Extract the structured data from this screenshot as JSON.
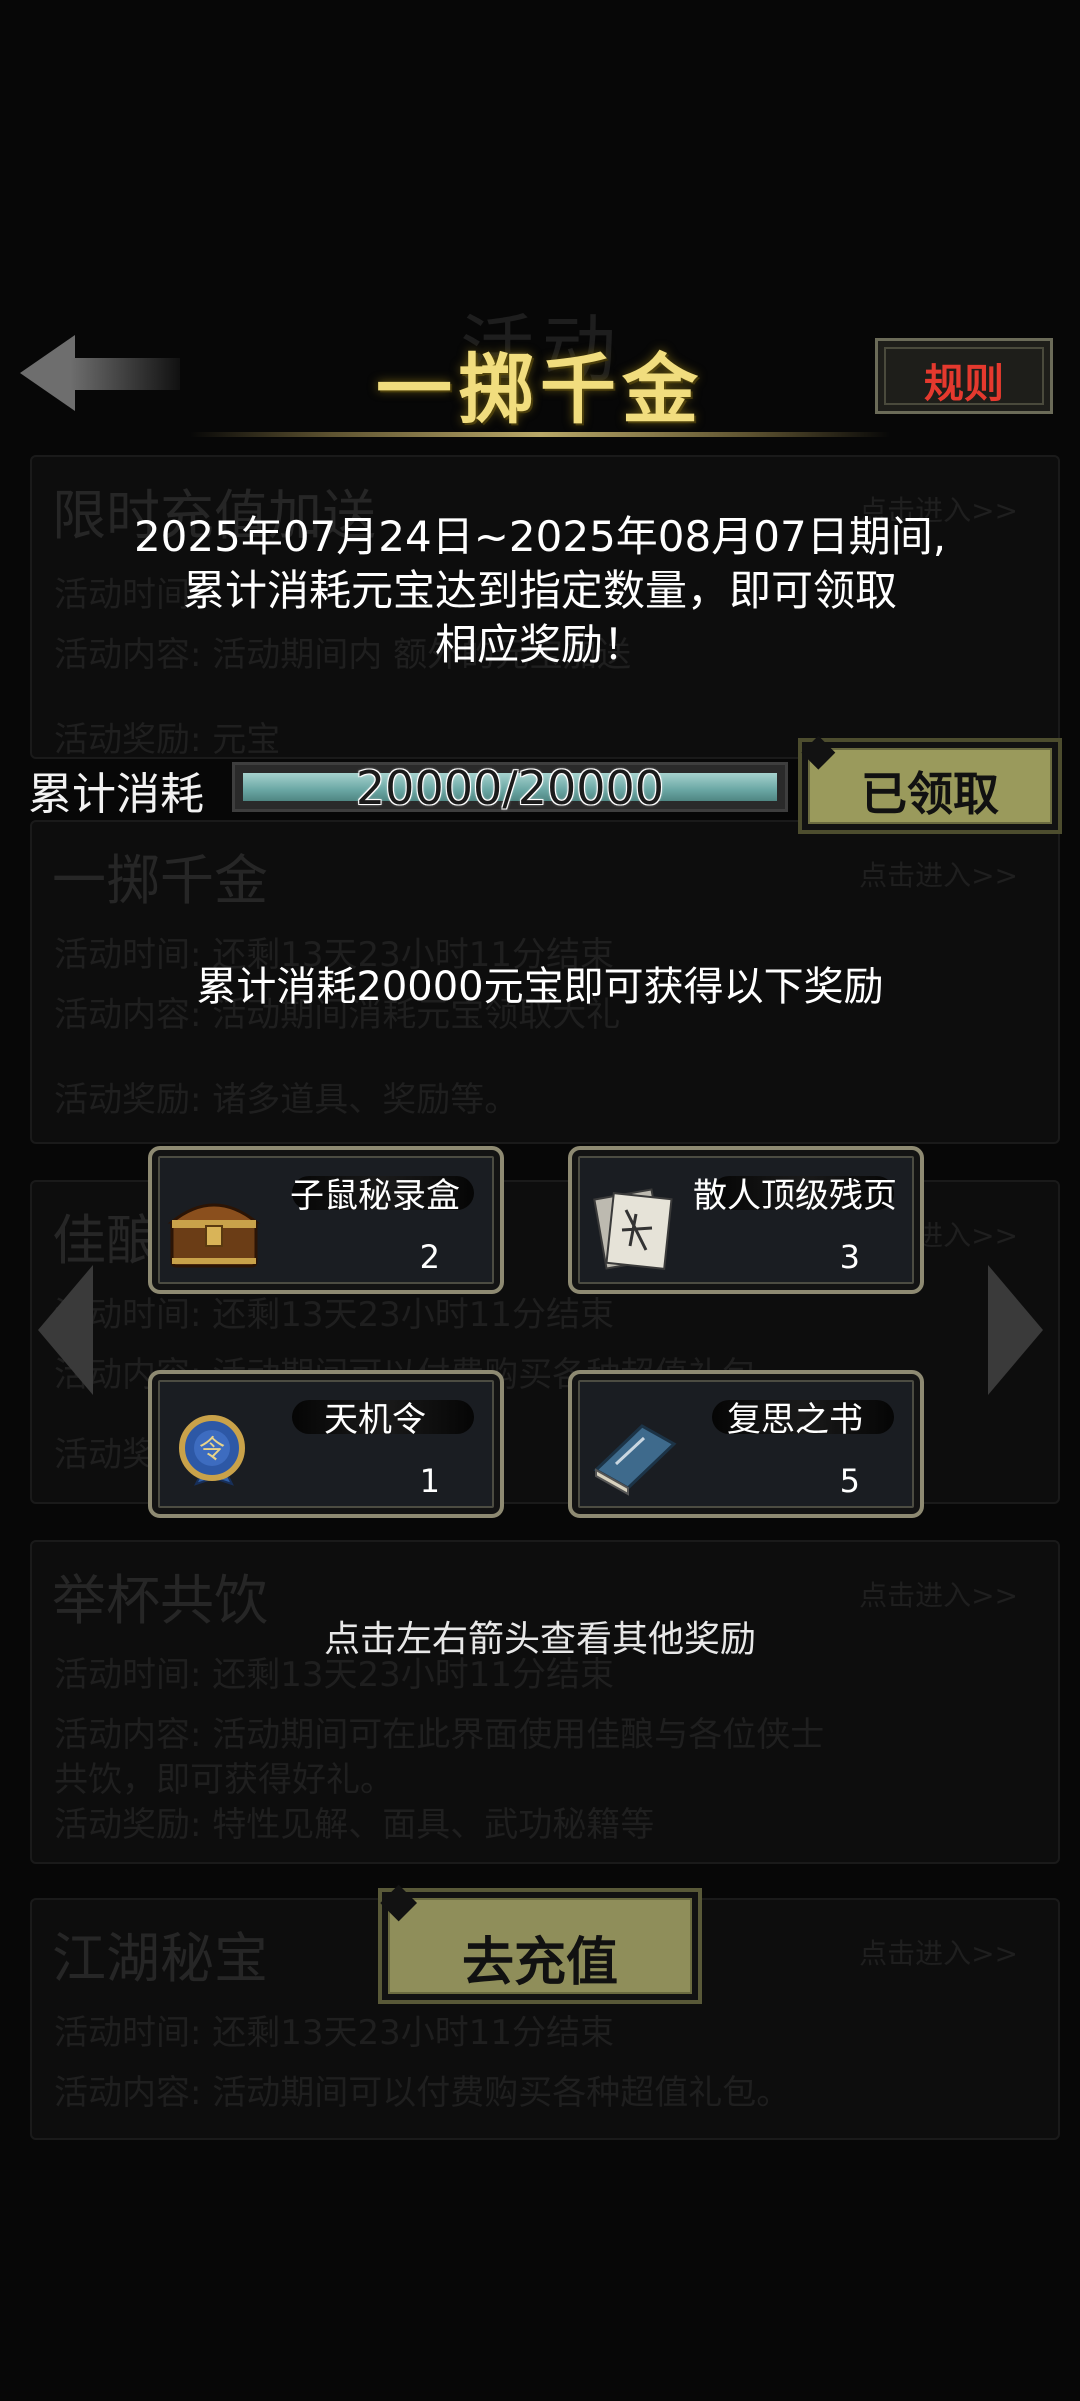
{
  "header": {
    "title": "一掷千金",
    "rules_label": "规则",
    "ghost_title": "活动"
  },
  "background_list": {
    "cards": [
      {
        "title": "限时充值加送",
        "enter": "点击进入>>",
        "lines": [
          "活动时间",
          "活动内容: 活动期间内                额外的元宝加送",
          "活动奖励: 元宝"
        ]
      },
      {
        "title": "一掷千金",
        "enter": "点击进入>>",
        "lines": [
          "活动时间: 还剩13天23小时11分结束",
          "活动内容: 活动期间消耗元宝领取大礼",
          "活动奖励: 诸多道具、奖励等。"
        ]
      },
      {
        "title": "佳酿",
        "enter": "点击进入>>",
        "lines": [
          "活动时间: 还剩13天23小时11分结束",
          "活动内容: 活动期间可以付费购买各种超值礼包",
          "活动奖"
        ]
      },
      {
        "title": "举杯共饮",
        "enter": "点击进入>>",
        "lines": [
          "活动时间: 还剩13天23小时11分结束",
          "活动内容: 活动期间可在此界面使用佳酿与各位侠士",
          "             共饮，即可获得好礼。",
          "活动奖励: 特性见解、面具、武功秘籍等"
        ]
      },
      {
        "title": "江湖秘宝",
        "enter": "点击进入>>",
        "lines": [
          "活动时间: 还剩13天23小时11分结束",
          "活动内容: 活动期间可以付费购买各种超值礼包。"
        ]
      }
    ]
  },
  "popup": {
    "description": [
      "2025年07月24日~2025年08月07日期间,",
      "累计消耗元宝达到指定数量，即可领取",
      "相应奖励！"
    ],
    "progress": {
      "label": "累计消耗",
      "text": "20000/20000",
      "current": 20000,
      "target": 20000
    },
    "claimed_label": "已领取",
    "reward_hint": "累计消耗20000元宝即可获得以下奖励",
    "rewards": [
      {
        "name": "子鼠秘录盒",
        "count": "2",
        "icon": "chest-icon"
      },
      {
        "name": "散人顶级残页",
        "count": "3",
        "icon": "scroll-pages-icon"
      },
      {
        "name": "天机令",
        "count": "1",
        "icon": "token-pouch-icon"
      },
      {
        "name": "复思之书",
        "count": "5",
        "icon": "book-icon"
      }
    ],
    "arrow_hint": "点击左右箭头查看其他奖励",
    "recharge_label": "去充值"
  },
  "colors": {
    "title_gold": "#f1dd7e",
    "rules_red": "#e5392e",
    "button_olive": "#9a9a5c",
    "progress_teal": "#6aa7a4"
  }
}
